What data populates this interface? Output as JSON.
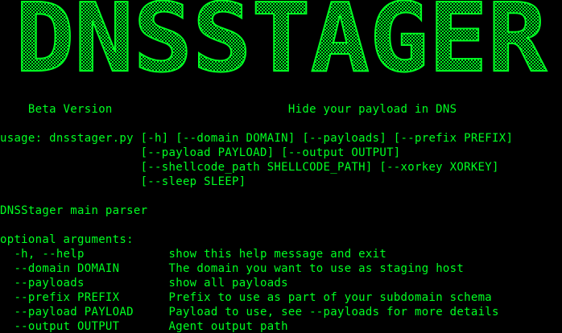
{
  "banner": {
    "text": "DNSSTAGER",
    "color": "#00ff22",
    "hatch_color": "#00ff22"
  },
  "header": {
    "version": "    Beta Version                         Hide your payload in DNS"
  },
  "usage": [
    "usage: dnsstager.py [-h] [--domain DOMAIN] [--payloads] [--prefix PREFIX]",
    "                    [--payload PAYLOAD] [--output OUTPUT]",
    "                    [--shellcode_path SHELLCODE_PATH] [--xorkey XORKEY]",
    "                    [--sleep SLEEP]"
  ],
  "description": "DNSStager main parser",
  "optional_header": "optional arguments:",
  "arguments": [
    {
      "flag": "  -h, --help            ",
      "help": "show this help message and exit"
    },
    {
      "flag": "  --domain DOMAIN       ",
      "help": "The domain you want to use as staging host"
    },
    {
      "flag": "  --payloads            ",
      "help": "show all payloads"
    },
    {
      "flag": "  --prefix PREFIX       ",
      "help": "Prefix to use as part of your subdomain schema"
    },
    {
      "flag": "  --payload PAYLOAD     ",
      "help": "Payload to use, see --payloads for more details"
    },
    {
      "flag": "  --output OUTPUT       ",
      "help": "Agent output path"
    }
  ]
}
